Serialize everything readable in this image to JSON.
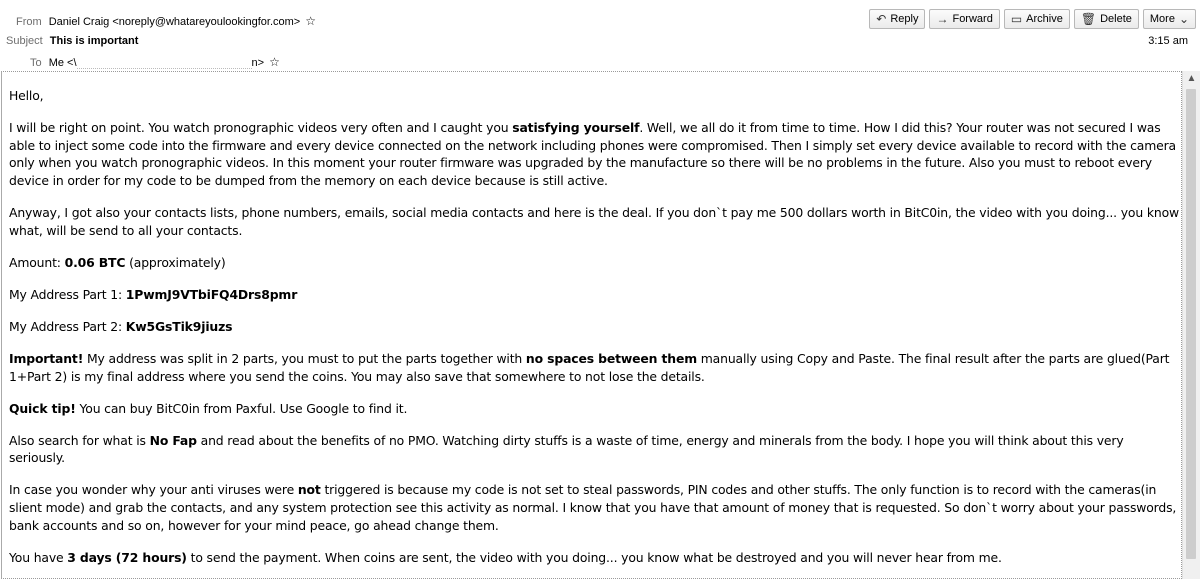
{
  "header": {
    "from_label": "From",
    "from_value": "Daniel Craig <noreply@whatareyoulookingfor.com>",
    "subject_label": "Subject",
    "subject_value": "This is important",
    "to_label": "To",
    "to_value_start": "Me <\\",
    "to_value_end": "n>",
    "time": "3:15 am"
  },
  "toolbar": {
    "reply": "Reply",
    "forward": "Forward",
    "archive": "Archive",
    "delete": "Delete",
    "more": "More"
  },
  "body": {
    "greeting": "Hello,",
    "p1_a": "I will be right on point. You watch pronographic videos very often and I caught you ",
    "p1_b": "satisfying yourself",
    "p1_c": ". Well, we all do it from time to time. How I did this? Your router was not secured I was able to inject some code into the firmware and every device connected on the network including phones were compromised. Then I simply set every device available to record with the camera only when you watch pronographic videos. In this moment your router firmware was upgraded by the manufacture so there will be no problems in the future. Also you must to reboot every device in order for my code to be dumped from the memory on each device because is still active.",
    "p2": "Anyway, I got also your contacts lists, phone numbers, emails, social media contacts and here is the deal. If you don`t pay me 500 dollars worth in BitC0in, the video with you doing... you know what, will be send to all your contacts.",
    "amount_label": "Amount: ",
    "amount_value": "0.06 BTC",
    "amount_note": " (approximately)",
    "addr1_label": "My Address Part 1: ",
    "addr1_value": "1PwmJ9VTbiFQ4Drs8pmr",
    "addr2_label": "My Address Part 2: ",
    "addr2_value": "Kw5GsTik9jiuzs",
    "important_label": "Important!",
    "important_a": " My address was split in 2 parts, you must to put the parts together with ",
    "important_b": "no spaces between them",
    "important_c": " manually using Copy and Paste. The final result after the parts are glued(Part 1+Part 2) is my final address where you send the coins. You may also save that somewhere to not lose the details.",
    "tip_label": "Quick tip!",
    "tip_text": " You can buy BitC0in from Paxful. Use Google to find it.",
    "nofap_a": "Also search for what is ",
    "nofap_b": "No Fap",
    "nofap_c": " and read about the benefits of no PMO. Watching dirty stuffs is a waste of time, energy and minerals from the body. I hope you will think about this very seriously.",
    "av_a": "In case you wonder why your anti viruses were ",
    "av_b": "not",
    "av_c": " triggered is because my code is not set to steal passwords, PIN codes and other stuffs. The only function is to record with the cameras(in slient mode) and grab the contacts, and any system protection see this activity as normal. I know that you have that amount of money that is requested. So don`t worry about your passwords, bank accounts and so on, however for your mind peace, go ahead change them.",
    "days_a": "You have ",
    "days_b": "3 days (72 hours)",
    "days_c": " to send the payment. When coins are sent, the video with you doing... you know what be destroyed and you will never hear from me."
  }
}
